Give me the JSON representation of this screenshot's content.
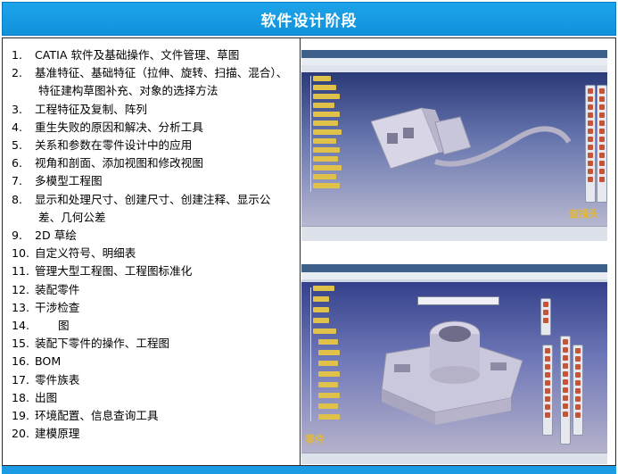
{
  "header": {
    "title": "软件设计阶段"
  },
  "topics": [
    {
      "num": "1.",
      "lines": [
        "CATIA 软件及基础操作、文件管理、草图"
      ]
    },
    {
      "num": "2.",
      "lines": [
        "基准特征、基础特征（拉伸、旋转、扫描、混合）、",
        "特征建构草图补充、对象的选择方法"
      ]
    },
    {
      "num": "3.",
      "lines": [
        "工程特征及复制、阵列"
      ]
    },
    {
      "num": "4.",
      "lines": [
        "重生失败的原因和解决、分析工具"
      ]
    },
    {
      "num": "5.",
      "lines": [
        "关系和参数在零件设计中的应用"
      ]
    },
    {
      "num": "6.",
      "lines": [
        "视角和剖面、添加视图和修改视图"
      ]
    },
    {
      "num": "7.",
      "lines": [
        "多模型工程图"
      ]
    },
    {
      "num": "8.",
      "lines": [
        "显示和处理尺寸、创建尺寸、创建注释、显示公",
        "差、几何公差"
      ]
    },
    {
      "num": "9.",
      "lines": [
        "2D 草绘"
      ]
    },
    {
      "num": "10.",
      "lines": [
        "自定义符号、明细表"
      ]
    },
    {
      "num": "11.",
      "lines": [
        "管理大型工程图、工程图标准化"
      ]
    },
    {
      "num": "12.",
      "lines": [
        "装配零件"
      ]
    },
    {
      "num": "13.",
      "lines": [
        "干涉检查"
      ]
    },
    {
      "num": "14.",
      "lines": [
        "图"
      ]
    },
    {
      "num": "15.",
      "lines": [
        "装配下零件的操作、工程图"
      ]
    },
    {
      "num": "16.",
      "lines": [
        "BOM"
      ]
    },
    {
      "num": "17.",
      "lines": [
        "零件族表"
      ]
    },
    {
      "num": "18.",
      "lines": [
        "出图"
      ]
    },
    {
      "num": "19.",
      "lines": [
        "环境配置、信息查询工具"
      ]
    },
    {
      "num": "20.",
      "lines": [
        "建模原理"
      ]
    }
  ],
  "screenshots": {
    "top_caption": "查插头",
    "bottom_caption": "零件"
  },
  "colors": {
    "header_blue": "#1b9be3",
    "caption_gold": "#e2b83a",
    "part_gray": "#c9c8dc"
  }
}
